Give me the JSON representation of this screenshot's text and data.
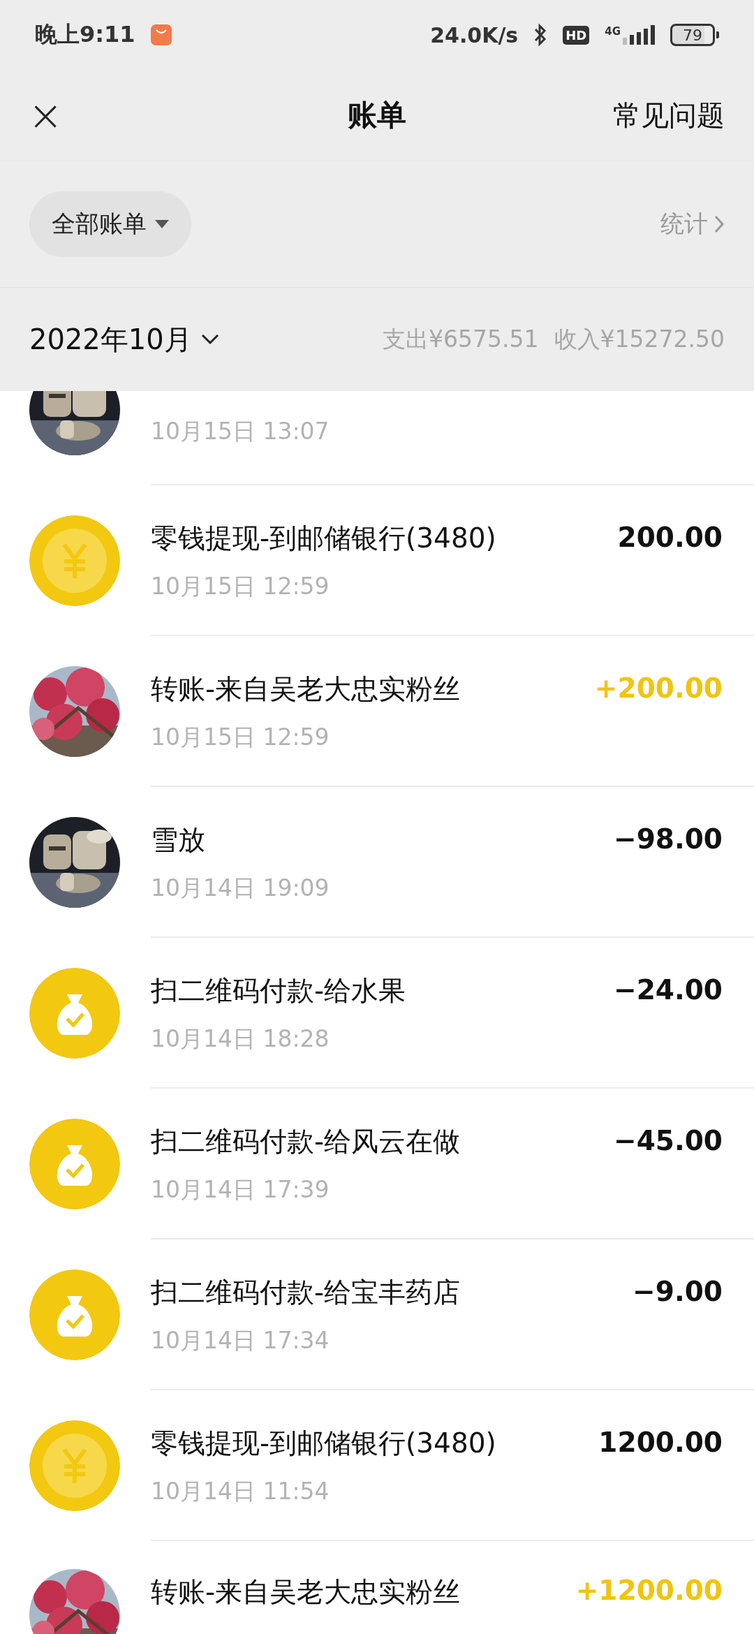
{
  "status_bar": {
    "time": "晚上9:11",
    "speed": "24.0K/s",
    "hd": "HD",
    "network": "4G",
    "battery": "79"
  },
  "header": {
    "close": "×",
    "title": "账单",
    "help": "常见问题"
  },
  "filter": {
    "label": "全部账单",
    "stats": "统计"
  },
  "month_bar": {
    "month": "2022年10月",
    "expense": "支出¥6575.51",
    "income": "收入¥15272.50"
  },
  "rows": [
    {
      "kind": "armor",
      "time": "10月15日 13:07",
      "clipped": true
    },
    {
      "kind": "coin",
      "title": "零钱提现-到邮储银行(3480)",
      "time": "10月15日 12:59",
      "amount": "200.00",
      "income": false
    },
    {
      "kind": "blossom",
      "title": "转账-来自吴老大忠实粉丝",
      "time": "10月15日 12:59",
      "amount": "+200.00",
      "income": true
    },
    {
      "kind": "armor",
      "title": "雪放",
      "time": "10月14日 19:09",
      "amount": "−98.00",
      "income": false
    },
    {
      "kind": "bag",
      "title": "扫二维码付款-给水果",
      "time": "10月14日 18:28",
      "amount": "−24.00",
      "income": false
    },
    {
      "kind": "bag",
      "title": "扫二维码付款-给风云在做",
      "time": "10月14日 17:39",
      "amount": "−45.00",
      "income": false
    },
    {
      "kind": "bag",
      "title": "扫二维码付款-给宝丰药店",
      "time": "10月14日 17:34",
      "amount": "−9.00",
      "income": false
    },
    {
      "kind": "coin",
      "title": "零钱提现-到邮储银行(3480)",
      "time": "10月14日 11:54",
      "amount": "1200.00",
      "income": false
    },
    {
      "kind": "blossom",
      "title": "转账-来自吴老大忠实粉丝",
      "amount": "+1200.00",
      "income": true
    }
  ]
}
